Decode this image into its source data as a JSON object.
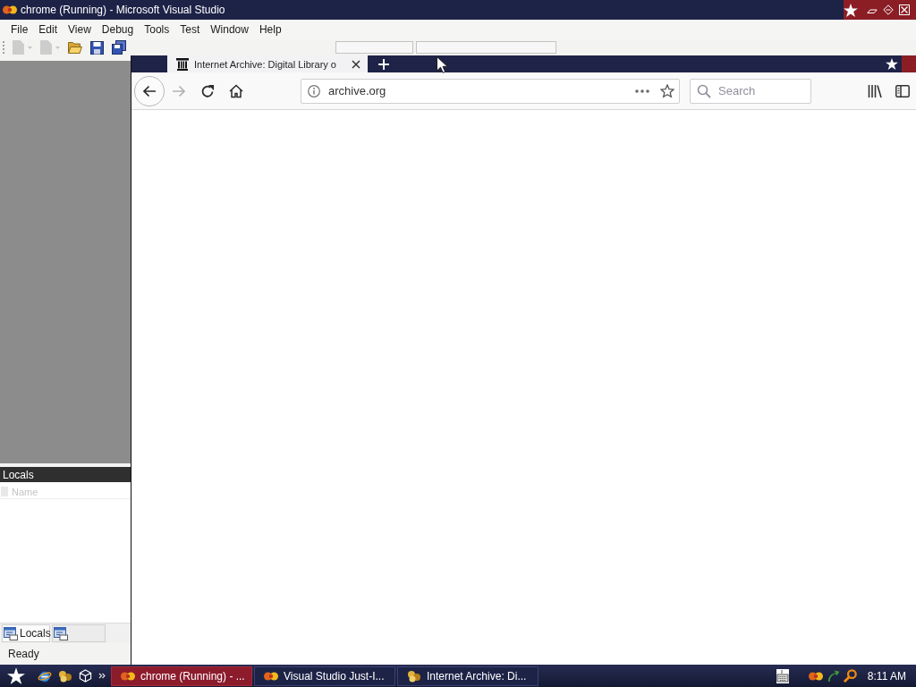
{
  "vs_window": {
    "title": "chrome (Running) - Microsoft Visual Studio",
    "menu": [
      "File",
      "Edit",
      "View",
      "Debug",
      "Tools",
      "Test",
      "Window",
      "Help"
    ],
    "toolbar": [
      {
        "kind": "new_project",
        "disabled": true
      },
      {
        "kind": "add_item",
        "disabled": true
      },
      {
        "kind": "open",
        "disabled": false
      },
      {
        "kind": "save",
        "disabled": false
      },
      {
        "kind": "save_all",
        "disabled": false
      }
    ],
    "locals_panel": {
      "title": "Locals",
      "columns": [
        "Name"
      ],
      "tabs": [
        {
          "label": "Locals",
          "selected": true
        },
        {
          "selected": false
        }
      ]
    },
    "status_bar": {
      "text": "Ready"
    }
  },
  "browser": {
    "tabs": [
      {
        "title": "Internet Archive: Digital Library o",
        "selected": true
      }
    ],
    "nav_buttons": [
      {
        "kind": "back",
        "disabled": false
      },
      {
        "kind": "forward",
        "disabled": true
      },
      {
        "kind": "reload",
        "disabled": false
      },
      {
        "kind": "home",
        "disabled": false
      }
    ],
    "url": "archive.org",
    "search": {
      "placeholder": "Search"
    }
  },
  "taskbar": {
    "buttons": [
      {
        "kind": "studio",
        "label": "chrome (Running) - ...",
        "selected": true
      },
      {
        "kind": "studio",
        "label": "Visual Studio Just-I...",
        "selected": false
      },
      {
        "kind": "browser",
        "label": "Internet Archive: Di...",
        "selected": false
      }
    ],
    "clock": "8:11 AM"
  }
}
